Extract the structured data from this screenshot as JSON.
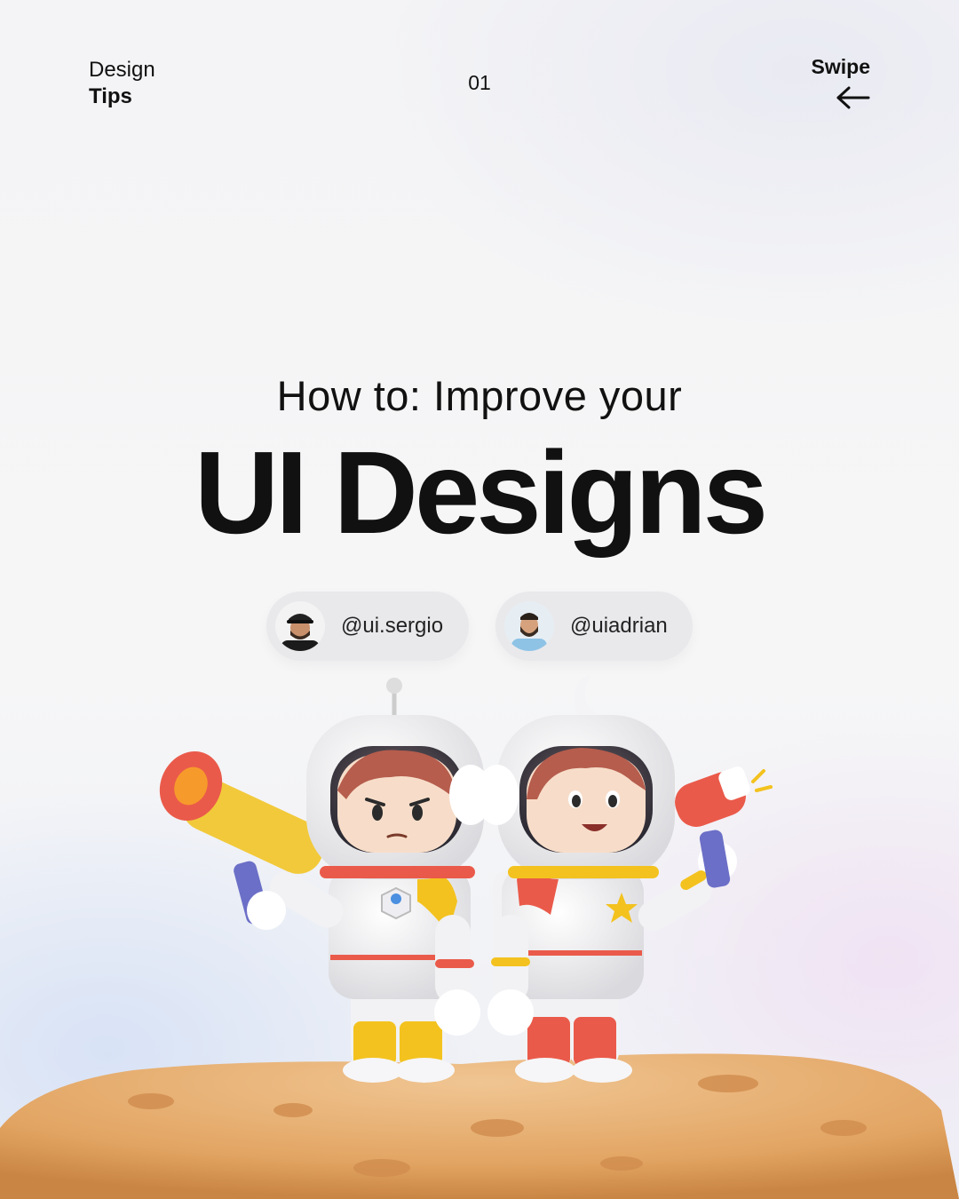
{
  "header": {
    "brand_line1": "Design",
    "brand_line2": "Tips",
    "page_number": "01",
    "swipe_label": "Swipe"
  },
  "hero": {
    "subtitle": "How to: Improve your",
    "title": "UI Designs"
  },
  "authors": [
    {
      "handle": "@ui.sergio",
      "icon": "avatar"
    },
    {
      "handle": "@uiadrian",
      "icon": "avatar"
    }
  ],
  "colors": {
    "text": "#111111",
    "chip_bg": "#e9e9ec",
    "planet": "#e2a967",
    "suit": "#f2f2f4",
    "accent_red": "#ea5a4a",
    "accent_yellow": "#f3c21e"
  }
}
